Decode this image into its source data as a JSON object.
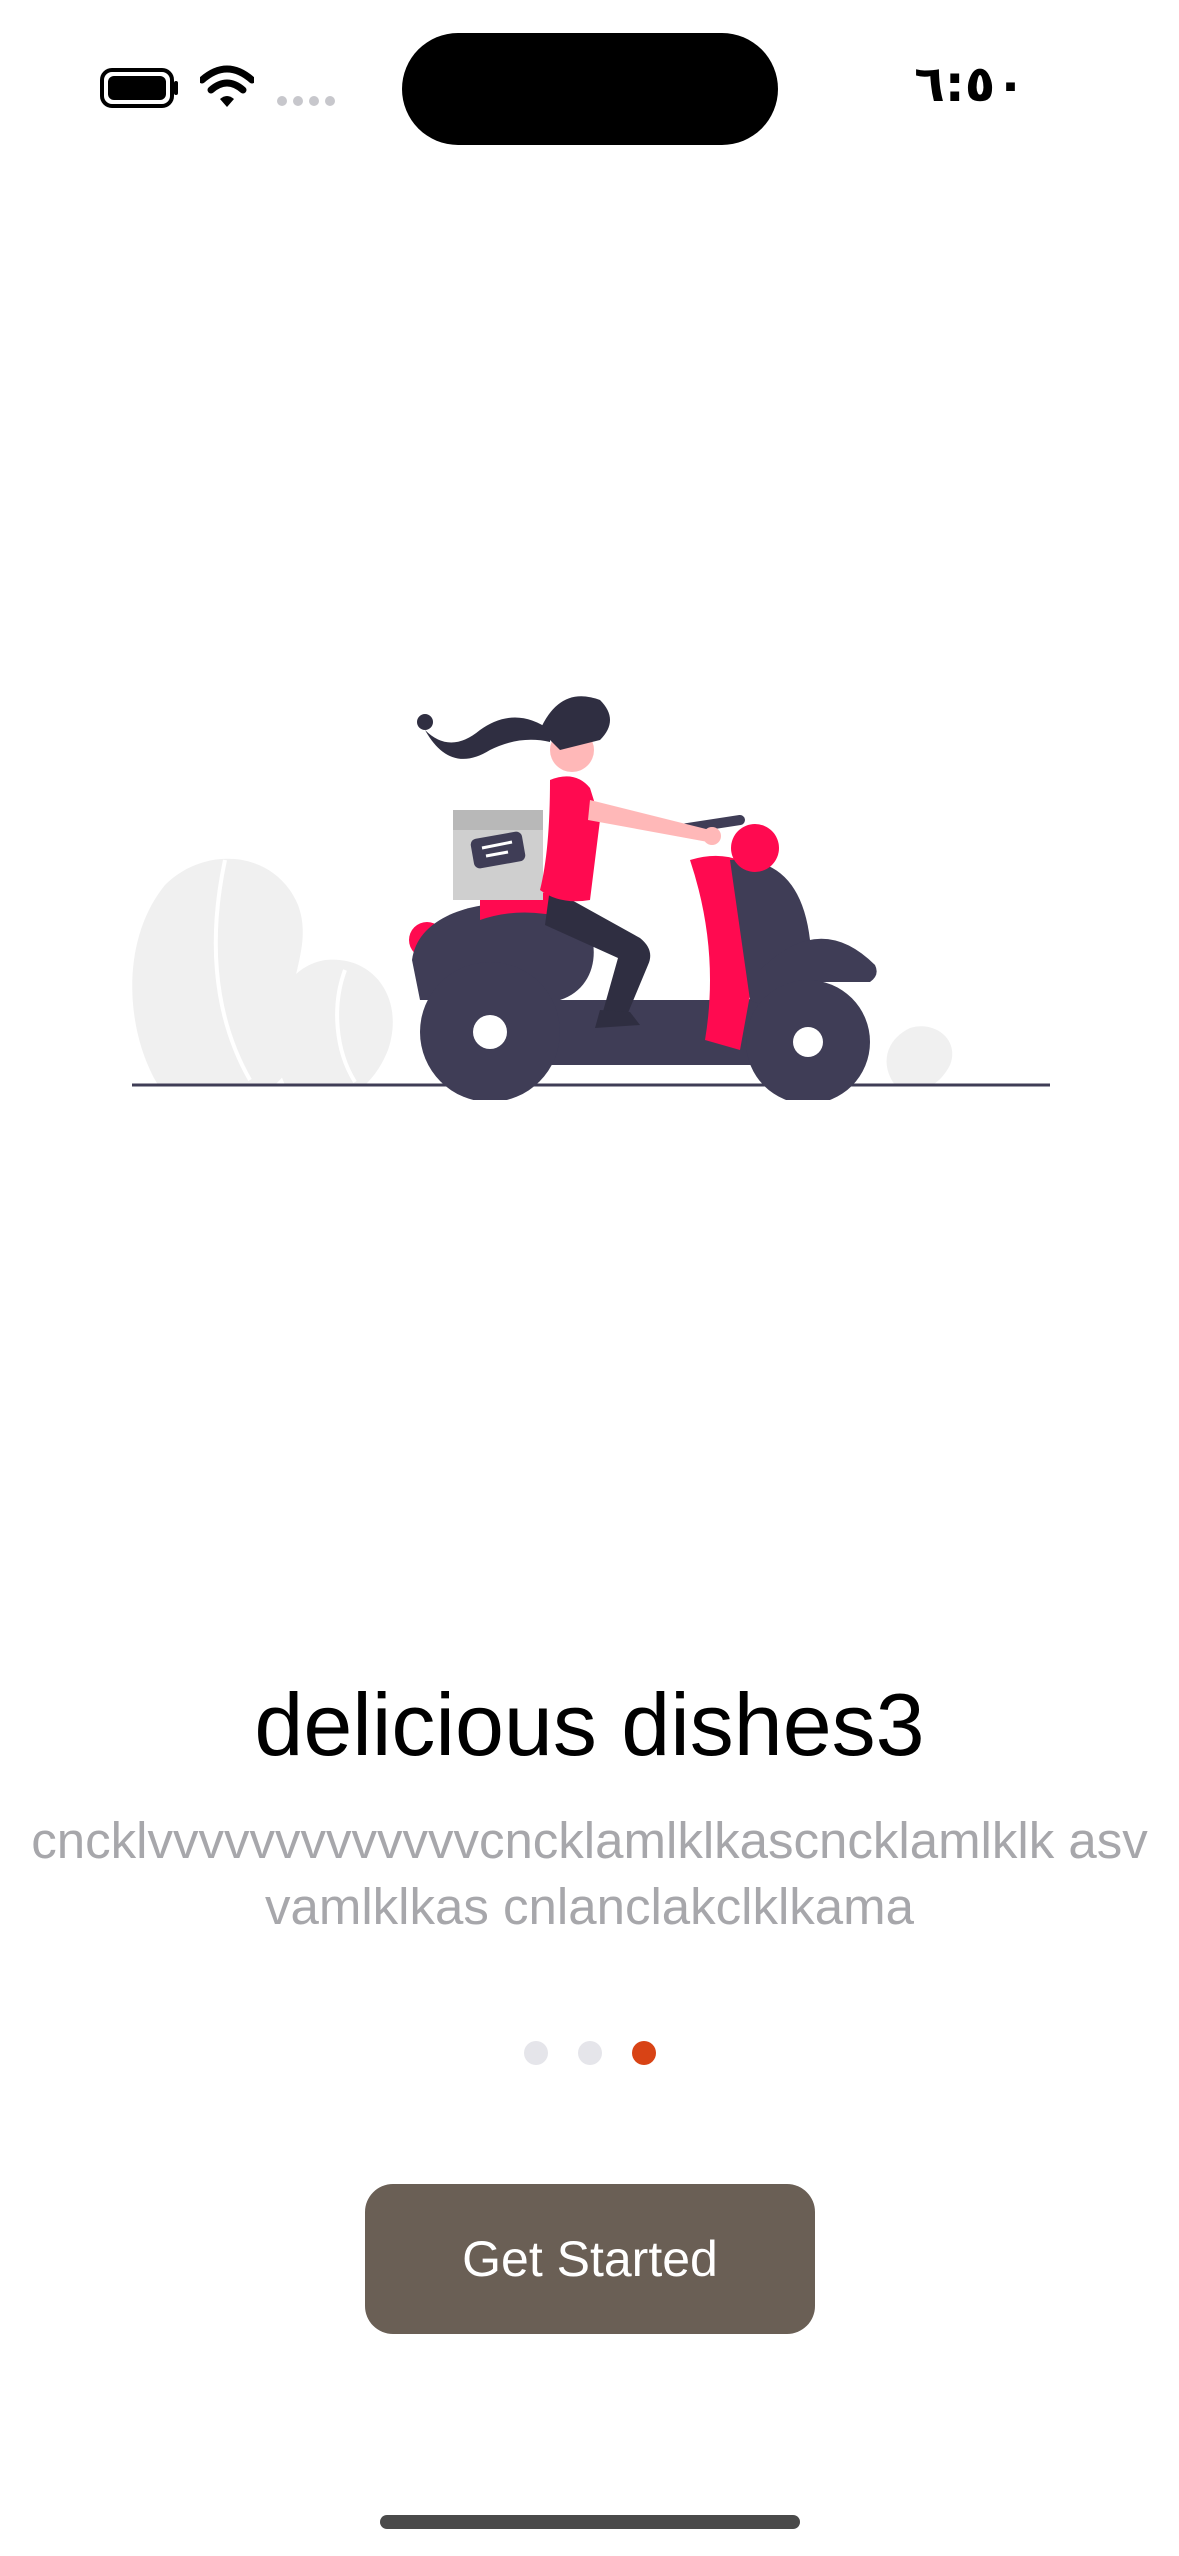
{
  "status_bar": {
    "time": "٦:٥٠",
    "battery_icon": "battery-full-icon",
    "wifi_icon": "wifi-icon",
    "signal_icon": "cellular-signal-icon"
  },
  "onboarding": {
    "illustration": "scooter-delivery-illustration",
    "title": "delicious dishes3",
    "subtitle": "cncklvvvvvvvvvvvvvcncklamlklkascncklamlklk asvvamlklkas cnlanclakclklkama",
    "pages": {
      "count": 3,
      "active_index": 2
    },
    "accent_color": "#d84315",
    "cta_label": "Get Started",
    "cta_color": "#6a5f55"
  }
}
